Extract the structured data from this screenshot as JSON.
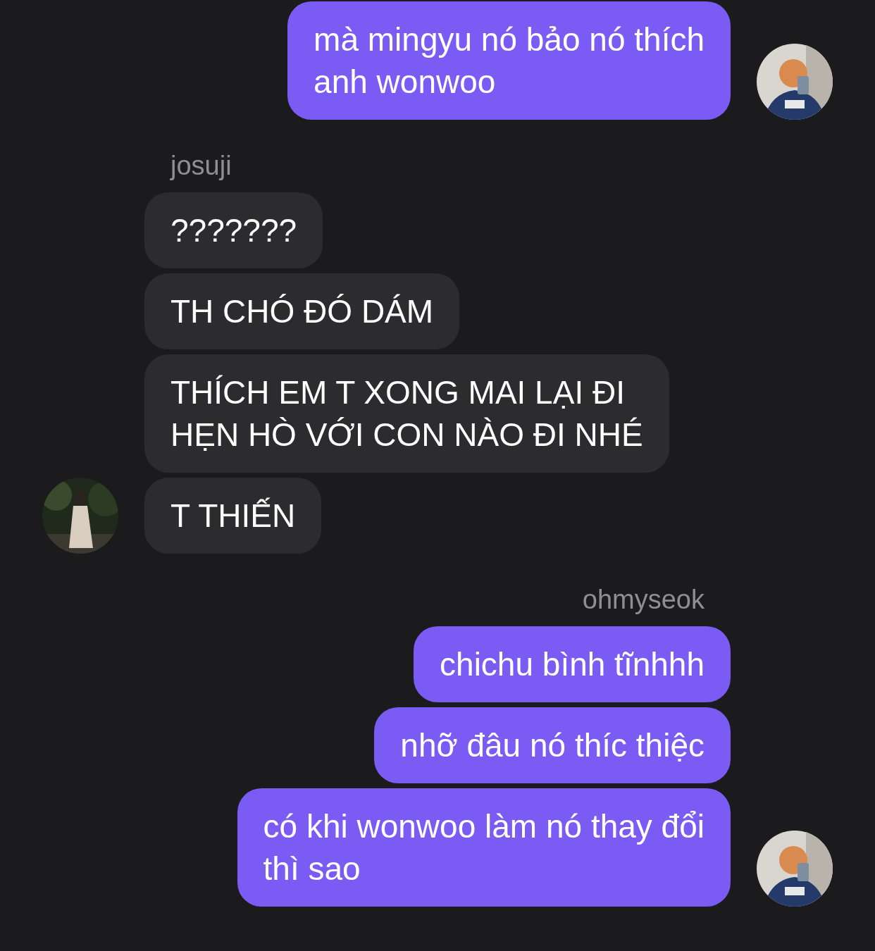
{
  "groups": [
    {
      "kind": "outgoing",
      "messages": [
        "mà mingyu nó bảo nó thích\nanh wonwoo"
      ]
    },
    {
      "kind": "incoming",
      "sender": "josuji",
      "messages": [
        "???????",
        "TH CHÓ ĐÓ DÁM",
        "THÍCH EM T XONG MAI LẠI ĐI\nHẸN HÒ VỚI CON NÀO ĐI NHÉ",
        "T THIẾN"
      ]
    },
    {
      "kind": "outgoing",
      "sender": "ohmyseok",
      "messages": [
        "chichu bình tĩnhhh",
        "nhỡ đâu nó thíc thiệc",
        "có khi wonwoo làm nó thay đổi\nthì sao"
      ]
    }
  ]
}
